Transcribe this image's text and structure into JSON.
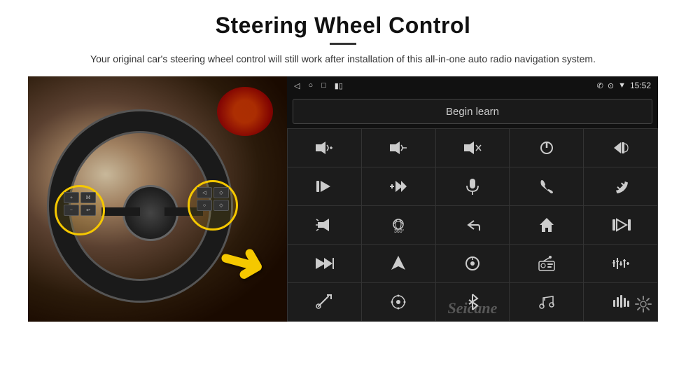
{
  "page": {
    "title": "Steering Wheel Control",
    "subtitle": "Your original car's steering wheel control will still work after installation of this all-in-one auto radio navigation system."
  },
  "status_bar": {
    "time": "15:52",
    "icons_left": [
      "◁",
      "○",
      "□",
      "▮▯"
    ],
    "icons_right": [
      "✆",
      "⊙",
      "▼"
    ]
  },
  "begin_learn": {
    "label": "Begin learn"
  },
  "controls": [
    {
      "icon": "🔊+",
      "label": "vol-up"
    },
    {
      "icon": "🔊-",
      "label": "vol-down"
    },
    {
      "icon": "🔇",
      "label": "mute"
    },
    {
      "icon": "⏻",
      "label": "power"
    },
    {
      "icon": "⏮",
      "label": "prev-call"
    },
    {
      "icon": "⏭",
      "label": "next-track"
    },
    {
      "icon": "✂⏭",
      "label": "fast-forward"
    },
    {
      "icon": "🎤",
      "label": "mic"
    },
    {
      "icon": "📞",
      "label": "phone"
    },
    {
      "icon": "📵",
      "label": "hang-up"
    },
    {
      "icon": "🔔",
      "label": "horn"
    },
    {
      "icon": "360",
      "label": "camera-360"
    },
    {
      "icon": "↩",
      "label": "back"
    },
    {
      "icon": "🏠",
      "label": "home"
    },
    {
      "icon": "⏮⏮",
      "label": "prev2"
    },
    {
      "icon": "⏭",
      "label": "skip"
    },
    {
      "icon": "▶",
      "label": "nav"
    },
    {
      "icon": "⏺",
      "label": "source"
    },
    {
      "icon": "📻",
      "label": "radio"
    },
    {
      "icon": "≡|≡",
      "label": "eq"
    },
    {
      "icon": "✏",
      "label": "steer-learn"
    },
    {
      "icon": "⊙",
      "label": "settings2"
    },
    {
      "icon": "✱",
      "label": "bluetooth"
    },
    {
      "icon": "🎵",
      "label": "music"
    },
    {
      "icon": "▐|▌",
      "label": "sound-bars"
    }
  ],
  "watermark": {
    "text": "Seicane"
  },
  "icons": {
    "gear": "⚙"
  }
}
